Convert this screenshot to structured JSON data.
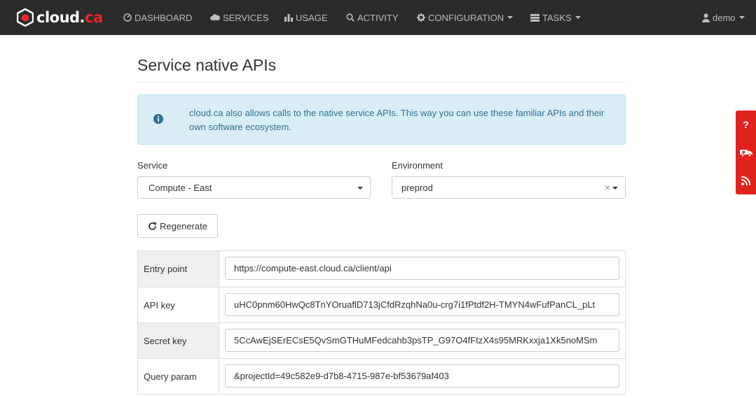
{
  "header": {
    "logo": {
      "part1": "cloud.",
      "part2": "ca"
    },
    "nav": [
      {
        "label": "DASHBOARD",
        "icon": "dashboard-icon"
      },
      {
        "label": "SERVICES",
        "icon": "cloud-icon"
      },
      {
        "label": "USAGE",
        "icon": "bar-chart-icon"
      },
      {
        "label": "ACTIVITY",
        "icon": "search-icon"
      },
      {
        "label": "CONFIGURATION",
        "icon": "gear-icon"
      },
      {
        "label": "TASKS",
        "icon": "tasks-icon"
      }
    ],
    "user": "demo"
  },
  "page": {
    "title": "Service native APIs",
    "info": "cloud.ca also allows calls to the native service APIs. This way you can use these familiar APIs and their own software ecosystem."
  },
  "form": {
    "service_label": "Service",
    "service_value": "Compute - East",
    "environment_label": "Environment",
    "environment_value": "preprod",
    "regenerate_label": "Regenerate"
  },
  "credentials": [
    {
      "key": "Entry point",
      "value": "https://compute-east.cloud.ca/client/api"
    },
    {
      "key": "API key",
      "value": "uHC0pnm60HwQc8TnYOruaflD713jCfdRzqhNa0u-crg7i1fPtdf2H-TMYN4wFufPanCL_pLt"
    },
    {
      "key": "Secret key",
      "value": "5CcAwEjSErECsE5QvSmGTHuMFedcahb3psTP_G97O4fFtzX4s95MRKxxja1Xk5noMSm"
    },
    {
      "key": "Query param",
      "value": "&projectId=49c582e9-d7b8-4715-987e-bf53679af403"
    }
  ],
  "side_tabs": [
    "help-icon",
    "ambulance-icon",
    "rss-icon"
  ],
  "colors": {
    "accent_red": "#e0231f",
    "info_bg": "#d9edf7",
    "info_text": "#31708f",
    "topbar": "#2b2b2b"
  }
}
